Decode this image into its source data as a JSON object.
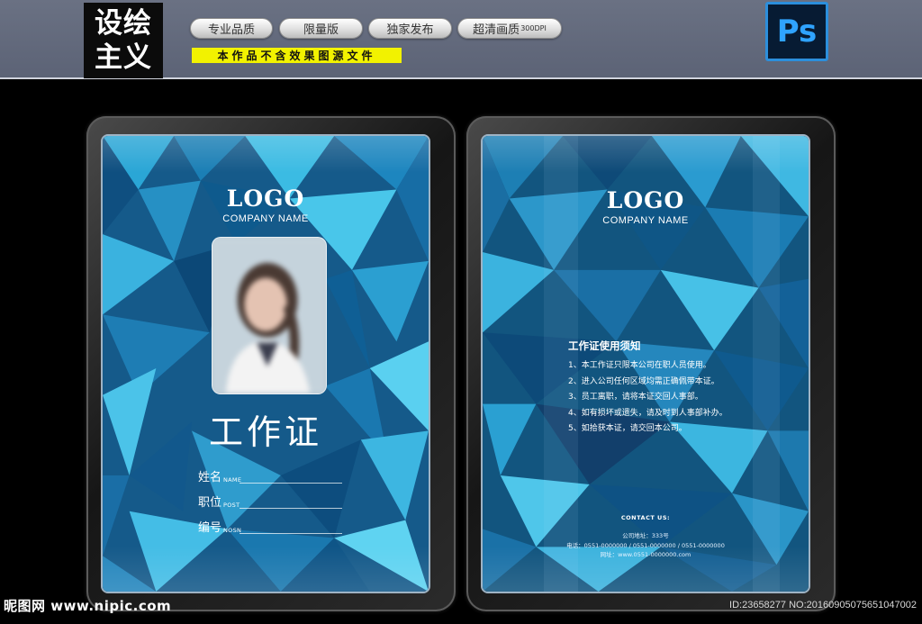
{
  "banner": {
    "brand_line1": "设绘",
    "brand_line2": "主义",
    "pills": [
      {
        "label": "专业品质",
        "suffix": ""
      },
      {
        "label": "限量版",
        "suffix": ""
      },
      {
        "label": "独家发布",
        "suffix": ""
      },
      {
        "label": "超清画质",
        "suffix": "300DPI"
      }
    ],
    "notice": "本作品不含效果图源文件",
    "ps_icon_text": "Ps",
    "ps_icon_name": "photoshop-icon"
  },
  "front_card": {
    "logo": "LOGO",
    "company": "COMPANY NAME",
    "title": "工作证",
    "fields": [
      {
        "cn": "姓名",
        "en": "NAME"
      },
      {
        "cn": "职位",
        "en": "POST"
      },
      {
        "cn": "编号",
        "en": "NOSN"
      }
    ]
  },
  "back_card": {
    "logo": "LOGO",
    "company": "COMPANY NAME",
    "rules_title": "工作证使用须知",
    "rules": [
      "1、本工作证只限本公司在职人员使用。",
      "2、进入公司任何区域均需正确佩带本证。",
      "3、员工离职，请将本证交回人事部。",
      "4、如有损坏或遗失，请及时到人事部补办。",
      "5、如拾获本证，请交回本公司。"
    ],
    "contact_title": "CONTACT US:",
    "contact_lines": [
      "公司地址：333号",
      "电话：0551-0000000 / 0551-0000000 / 0551-0000000",
      "网址：www.0551-0000000.com"
    ]
  },
  "watermark": {
    "left": "昵图网 www.nipic.com",
    "right": "ID:23658277 NO:20160905075651047002"
  },
  "colors": {
    "banner": "#5f6679",
    "notice_bg": "#f2f200",
    "card_blue": "#1f6fa0",
    "ps_blue": "#2fa3ff"
  }
}
